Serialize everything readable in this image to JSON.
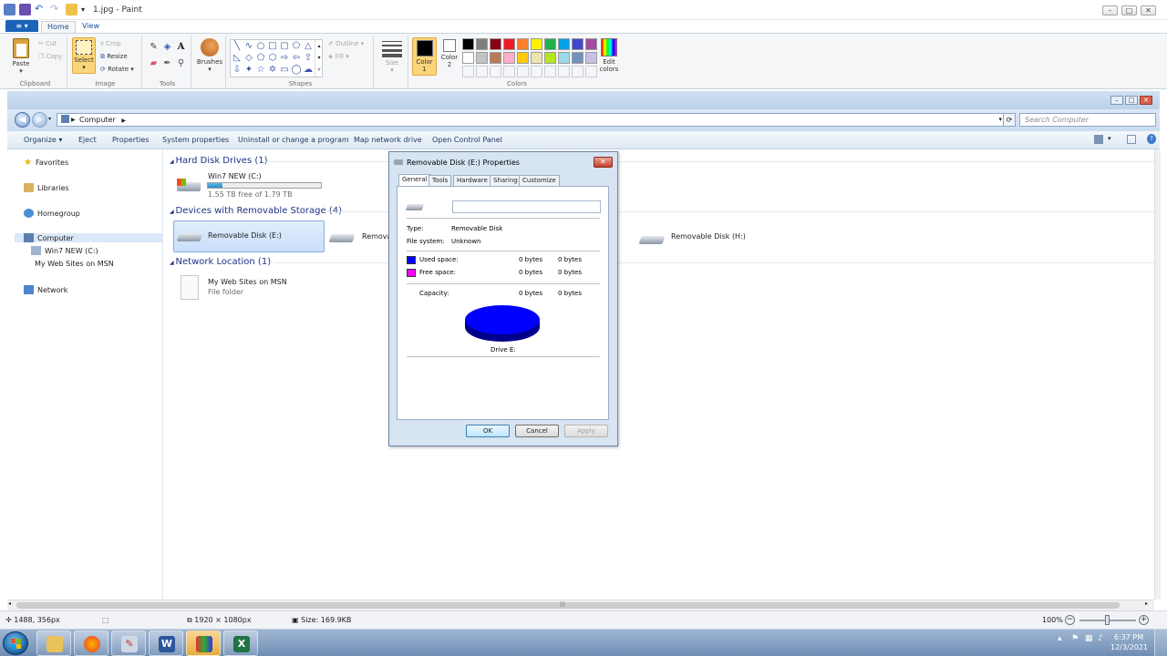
{
  "paint": {
    "title": "1.jpg - Paint",
    "window_buttons": [
      "–",
      "□",
      "✕"
    ],
    "tabs": {
      "file": "≡ ▾",
      "home": "Home",
      "view": "View"
    },
    "clipboard": {
      "paste": "Paste",
      "cut": "Cut",
      "copy": "Copy",
      "label": "Clipboard"
    },
    "image": {
      "select": "Select",
      "crop": "Crop",
      "resize": "Resize",
      "rotate": "Rotate",
      "label": "Image"
    },
    "tools": {
      "label": "Tools"
    },
    "brushes": {
      "label": "Brushes"
    },
    "shapes": {
      "outline": "Outline",
      "fill": "Fill",
      "label": "Shapes"
    },
    "size": {
      "label": "Size"
    },
    "color1": {
      "label": "Color",
      "num": "1"
    },
    "color2": {
      "label": "Color",
      "num": "2"
    },
    "edit_colors": {
      "line1": "Edit",
      "line2": "colors"
    },
    "colors_label": "Colors",
    "palette": [
      "#000000",
      "#7f7f7f",
      "#880015",
      "#ed1c24",
      "#ff7f27",
      "#fff200",
      "#22b14c",
      "#00a2e8",
      "#3f48cc",
      "#a349a4",
      "#ffffff",
      "#c3c3c3",
      "#b97a57",
      "#ffaec9",
      "#ffc90e",
      "#efe4b0",
      "#b5e61d",
      "#99d9ea",
      "#7092be",
      "#c8bfe7"
    ],
    "status": {
      "cursor": "1488, 356px",
      "dimensions": "1920 × 1080px",
      "size": "Size: 169.9KB",
      "zoom": "100%",
      "zoom_level": 0.5
    }
  },
  "explorer": {
    "address": "Computer",
    "search_placeholder": "Search Computer",
    "commands": [
      "Organize ▾",
      "Eject",
      "Properties",
      "System properties",
      "Uninstall or change a program",
      "Map network drive",
      "Open Control Panel"
    ],
    "nav": {
      "favorites": "Favorites",
      "libraries": "Libraries",
      "homegroup": "Homegroup",
      "computer": "Computer",
      "win7": "Win7 NEW (C:)",
      "websites": "My Web Sites on MSN",
      "network": "Network"
    },
    "groups": {
      "hdd": "Hard Disk Drives (1)",
      "removable": "Devices with Removable Storage (4)",
      "network": "Network Location (1)"
    },
    "c_drive": {
      "name": "Win7 NEW (C:)",
      "free": "1.55 TB free of 1.79 TB",
      "used_fraction": 0.13
    },
    "removable": {
      "e": "Removable Disk (E:)",
      "f": "Remova",
      "h": "Removable Disk (H:)"
    },
    "network_item": {
      "name": "My Web Sites on MSN",
      "type": "File folder"
    }
  },
  "dialog": {
    "title": "Removable Disk (E:) Properties",
    "tabs": [
      "General",
      "Tools",
      "Hardware",
      "Sharing",
      "Customize"
    ],
    "type_label": "Type:",
    "type_value": "Removable Disk",
    "fs_label": "File system:",
    "fs_value": "Unknown",
    "used_label": "Used space:",
    "used_bytes": "0 bytes",
    "used_bytes2": "0 bytes",
    "free_label": "Free space:",
    "free_bytes": "0 bytes",
    "free_bytes2": "0 bytes",
    "capacity_label": "Capacity:",
    "cap_bytes": "0 bytes",
    "cap_bytes2": "0 bytes",
    "drive_label": "Drive E:",
    "used_color": "#0000ff",
    "free_color": "#ff00ff",
    "ok": "OK",
    "cancel": "Cancel",
    "apply": "Apply"
  },
  "taskbar": {
    "time": "6:37 PM",
    "date": "12/3/2021"
  }
}
